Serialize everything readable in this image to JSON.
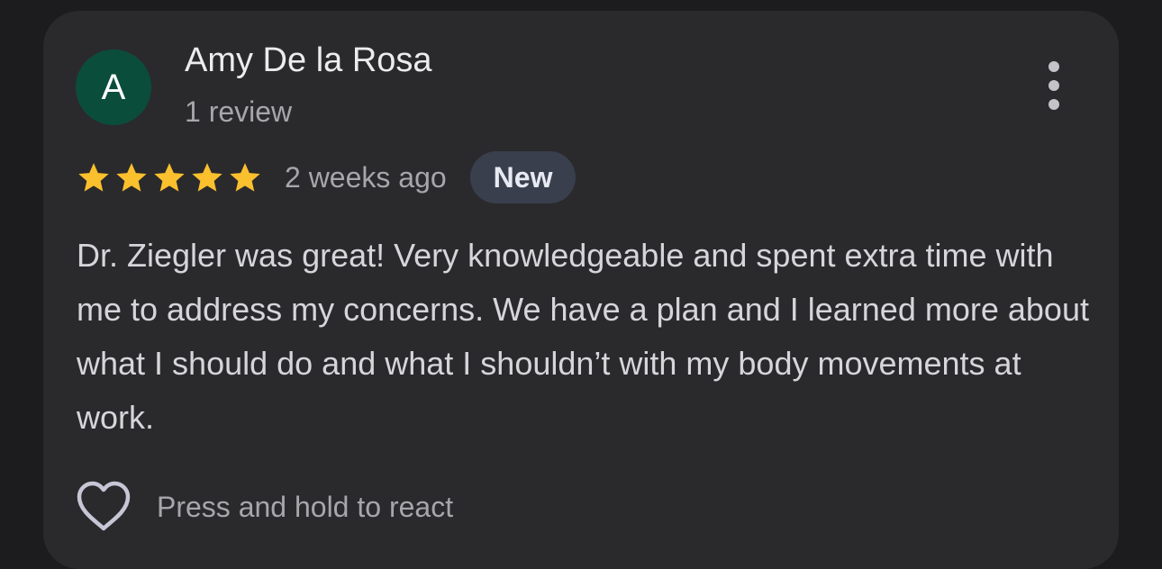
{
  "review": {
    "avatar_initial": "A",
    "author_name": "Amy De la Rosa",
    "review_count": "1 review",
    "rating": 5,
    "rating_max": 5,
    "time_ago": "2 weeks ago",
    "badge": "New",
    "text": "Dr. Ziegler was great! Very knowledgeable and spent extra time with me to address my concerns. We have a plan and I learned more about what I should do and what I shouldn’t with my body movements at work.",
    "react_label": "Press and hold to react"
  },
  "icons": {
    "more": "more-vert-icon",
    "star": "star-icon",
    "heart": "heart-outline-icon"
  },
  "colors": {
    "background": "#1c1c1e",
    "card": "#2a2a2c",
    "avatar": "#0b4d3b",
    "star": "#fbc02d",
    "badge_bg": "#3a3f4e"
  }
}
